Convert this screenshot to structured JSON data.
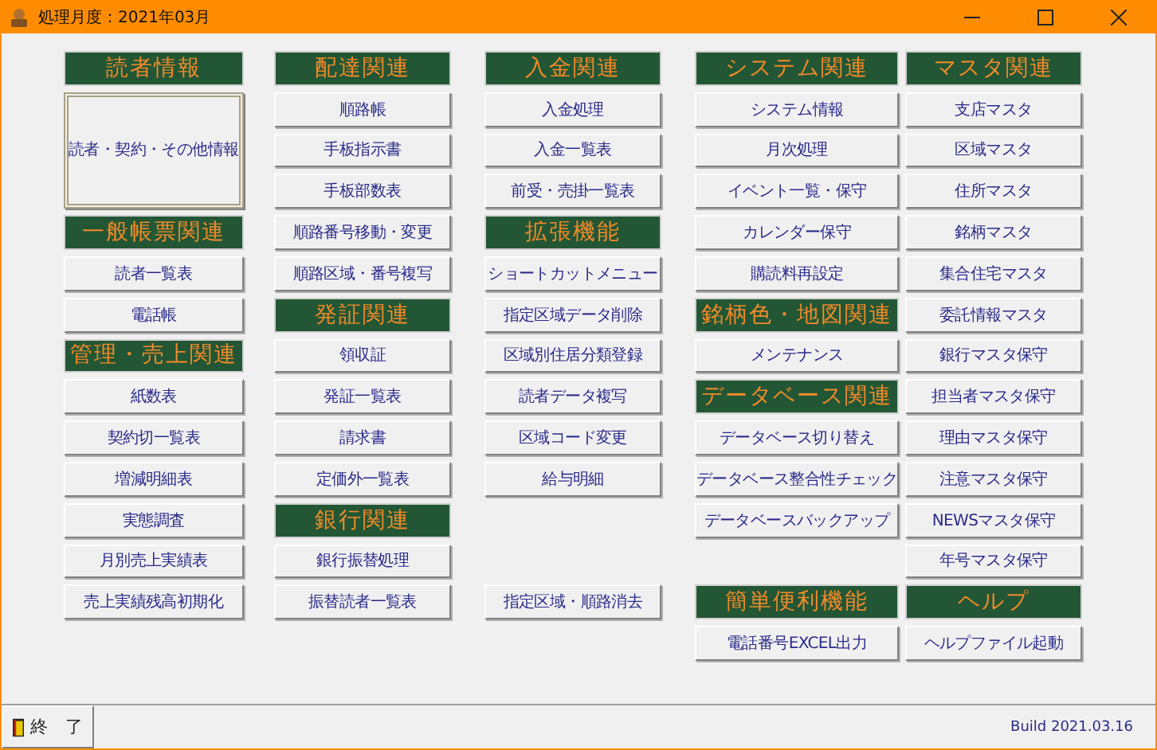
{
  "window": {
    "title": "処理月度：2021年03月"
  },
  "columns": [
    {
      "items": [
        {
          "kind": "header",
          "label": "読者情報"
        },
        {
          "kind": "large",
          "label": "読者・契約・その他情報"
        },
        {
          "kind": "header",
          "label": "一般帳票関連"
        },
        {
          "kind": "button",
          "label": "読者一覧表"
        },
        {
          "kind": "button",
          "label": "電話帳"
        },
        {
          "kind": "header",
          "label": "管理・売上関連"
        },
        {
          "kind": "button",
          "label": "紙数表"
        },
        {
          "kind": "button",
          "label": "契約切一覧表"
        },
        {
          "kind": "button",
          "label": "増減明細表"
        },
        {
          "kind": "button",
          "label": "実態調査"
        },
        {
          "kind": "button",
          "label": "月別売上実績表"
        },
        {
          "kind": "button",
          "label": "売上実績残高初期化"
        }
      ]
    },
    {
      "items": [
        {
          "kind": "header",
          "label": "配達関連"
        },
        {
          "kind": "button",
          "label": "順路帳"
        },
        {
          "kind": "button",
          "label": "手板指示書"
        },
        {
          "kind": "button",
          "label": "手板部数表"
        },
        {
          "kind": "button",
          "label": "順路番号移動・変更"
        },
        {
          "kind": "button",
          "label": "順路区域・番号複写"
        },
        {
          "kind": "header",
          "label": "発証関連"
        },
        {
          "kind": "button",
          "label": "領収証"
        },
        {
          "kind": "button",
          "label": "発証一覧表"
        },
        {
          "kind": "button",
          "label": "請求書"
        },
        {
          "kind": "button",
          "label": "定価外一覧表"
        },
        {
          "kind": "header",
          "label": "銀行関連"
        },
        {
          "kind": "button",
          "label": "銀行振替処理"
        },
        {
          "kind": "button",
          "label": "振替読者一覧表"
        }
      ]
    },
    {
      "items": [
        {
          "kind": "header",
          "label": "入金関連"
        },
        {
          "kind": "button",
          "label": "入金処理"
        },
        {
          "kind": "button",
          "label": "入金一覧表"
        },
        {
          "kind": "button",
          "label": "前受・売掛一覧表"
        },
        {
          "kind": "header",
          "label": "拡張機能"
        },
        {
          "kind": "button",
          "label": "ショートカットメニュー"
        },
        {
          "kind": "button",
          "label": "指定区域データ削除"
        },
        {
          "kind": "button",
          "label": "区域別住居分類登録"
        },
        {
          "kind": "button",
          "label": "読者データ複写"
        },
        {
          "kind": "button",
          "label": "区域コード変更"
        },
        {
          "kind": "button",
          "label": "給与明細"
        },
        {
          "kind": "gap"
        },
        {
          "kind": "gap"
        },
        {
          "kind": "button",
          "label": "指定区域・順路消去"
        }
      ]
    },
    {
      "items": [
        {
          "kind": "header",
          "label": "システム関連"
        },
        {
          "kind": "button",
          "label": "システム情報"
        },
        {
          "kind": "button",
          "label": "月次処理"
        },
        {
          "kind": "button",
          "label": "イベント一覧・保守"
        },
        {
          "kind": "button",
          "label": "カレンダー保守"
        },
        {
          "kind": "button",
          "label": "購読料再設定"
        },
        {
          "kind": "header",
          "label": "銘柄色・地図関連"
        },
        {
          "kind": "button",
          "label": "メンテナンス"
        },
        {
          "kind": "header",
          "label": "データベース関連"
        },
        {
          "kind": "button",
          "label": "データベース切り替え"
        },
        {
          "kind": "button",
          "label": "データベース整合性チェック"
        },
        {
          "kind": "button",
          "label": "データベースバックアップ"
        },
        {
          "kind": "gap"
        },
        {
          "kind": "header",
          "label": "簡単便利機能"
        },
        {
          "kind": "button",
          "label": "電話番号EXCEL出力"
        }
      ]
    },
    {
      "items": [
        {
          "kind": "header",
          "label": "マスタ関連"
        },
        {
          "kind": "button",
          "label": "支店マスタ"
        },
        {
          "kind": "button",
          "label": "区域マスタ"
        },
        {
          "kind": "button",
          "label": "住所マスタ"
        },
        {
          "kind": "button",
          "label": "銘柄マスタ"
        },
        {
          "kind": "button",
          "label": "集合住宅マスタ"
        },
        {
          "kind": "button",
          "label": "委託情報マスタ"
        },
        {
          "kind": "button",
          "label": "銀行マスタ保守"
        },
        {
          "kind": "button",
          "label": "担当者マスタ保守"
        },
        {
          "kind": "button",
          "label": "理由マスタ保守"
        },
        {
          "kind": "button",
          "label": "注意マスタ保守"
        },
        {
          "kind": "button",
          "label": "NEWSマスタ保守"
        },
        {
          "kind": "button",
          "label": "年号マスタ保守"
        },
        {
          "kind": "header",
          "label": "ヘルプ"
        },
        {
          "kind": "button",
          "label": "ヘルプファイル起動"
        }
      ]
    }
  ],
  "footer": {
    "exit_button": "終　了",
    "build": "Build 2021.03.16"
  }
}
